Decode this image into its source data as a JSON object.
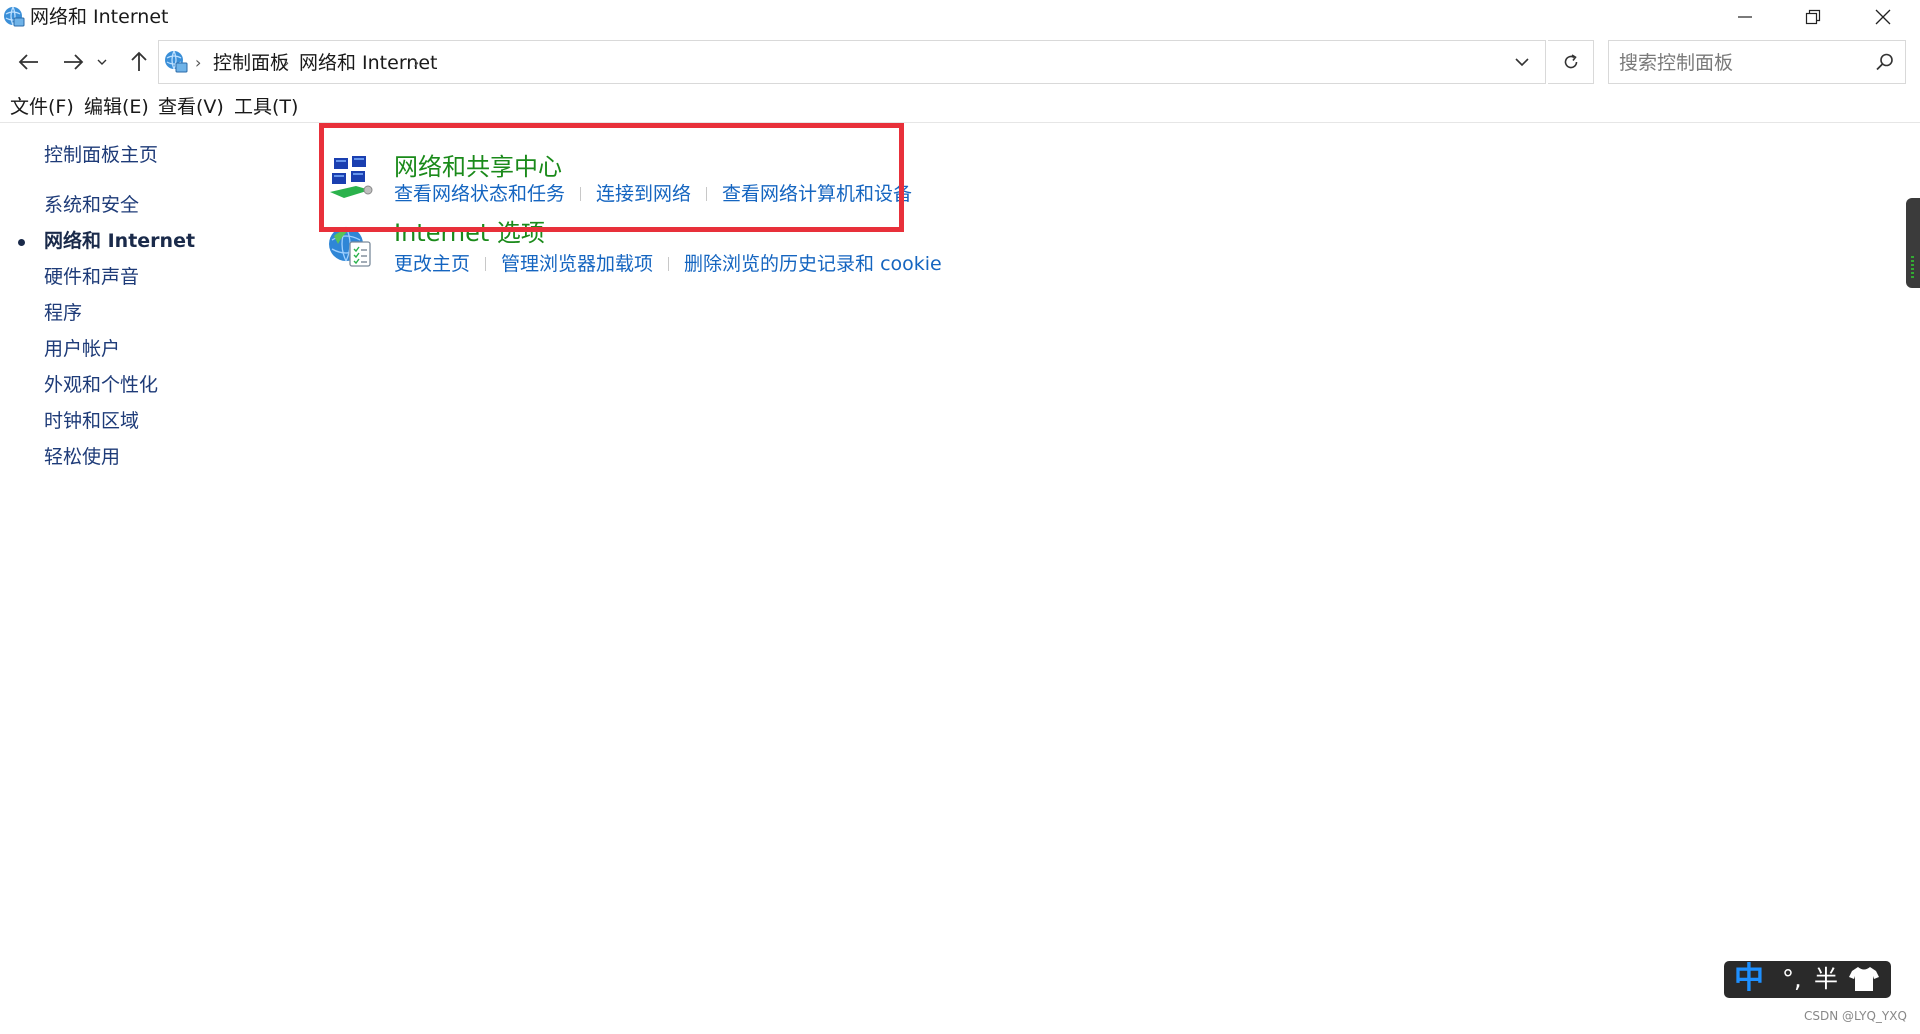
{
  "window": {
    "title": "网络和 Internet"
  },
  "navigation": {
    "breadcrumbs": [
      "控制面板",
      "网络和 Internet"
    ],
    "search_placeholder": "搜索控制面板"
  },
  "menu": {
    "items": [
      "文件(F)",
      "编辑(E)",
      "查看(V)",
      "工具(T)"
    ]
  },
  "sidebar": {
    "items": [
      {
        "label": "控制面板主页",
        "active": false
      },
      {
        "label": "系统和安全",
        "active": false
      },
      {
        "label": "网络和 Internet",
        "active": true
      },
      {
        "label": "硬件和声音",
        "active": false
      },
      {
        "label": "程序",
        "active": false
      },
      {
        "label": "用户帐户",
        "active": false
      },
      {
        "label": "外观和个性化",
        "active": false
      },
      {
        "label": "时钟和区域",
        "active": false
      },
      {
        "label": "轻松使用",
        "active": false
      }
    ]
  },
  "categories": [
    {
      "title": "网络和共享中心",
      "icon": "network-sharing-center-icon",
      "links": [
        "查看网络状态和任务",
        "连接到网络",
        "查看网络计算机和设备"
      ]
    },
    {
      "title": "Internet 选项",
      "icon": "internet-options-icon",
      "links": [
        "更改主页",
        "管理浏览器加载项",
        "删除浏览的历史记录和 cookie"
      ]
    }
  ],
  "ime": {
    "mode": "中",
    "punctuation": "°,",
    "width": "半"
  },
  "watermark": "CSDN @LYQ_YXQ",
  "colors": {
    "highlight": "#e8303a",
    "category_title": "#1a8a1a",
    "link": "#1565c0",
    "sidebar_link": "#1e3b78"
  }
}
